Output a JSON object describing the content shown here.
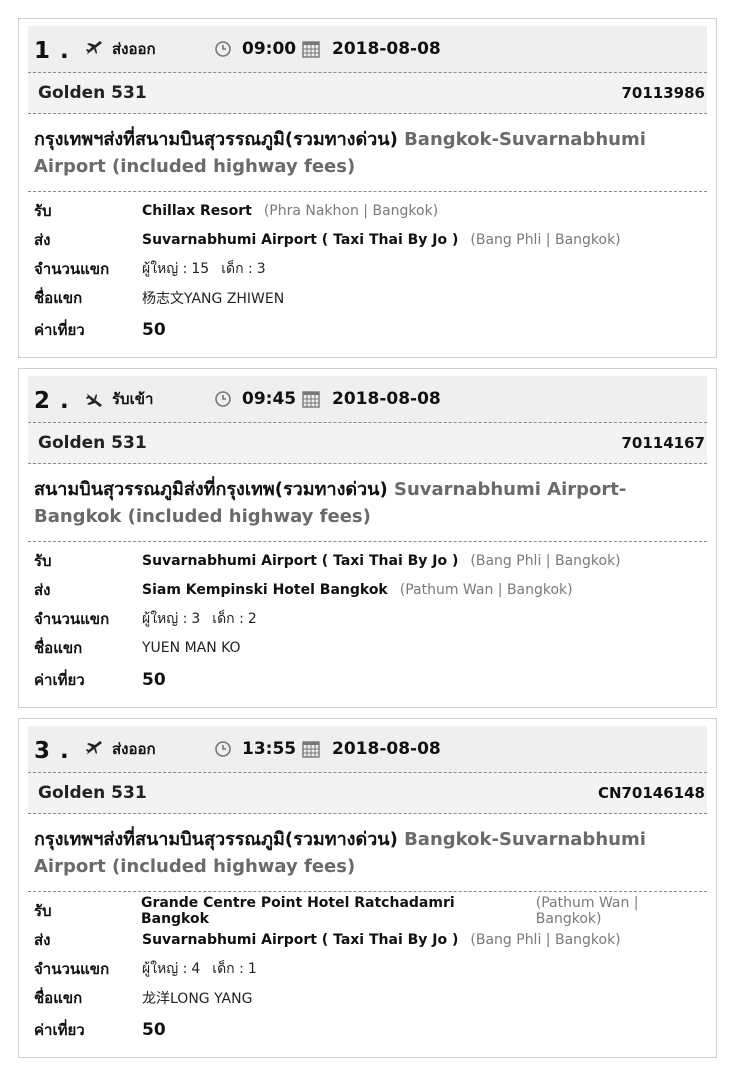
{
  "colors": {
    "header_bg": "#efefef",
    "subheader_bg": "#f3f3f3",
    "border": "#cfcfcf",
    "muted": "#6a6a6a"
  },
  "labels": {
    "pickup": "รับ",
    "dropoff": "ส่ง",
    "passengers": "จำนวนแขก",
    "guest_name": "ชื่อแขก",
    "fare": "ค่าเที่ยว",
    "adult": "ผู้ใหญ่ :",
    "child": "เด็ก :"
  },
  "bookings": [
    {
      "number": "1 .",
      "type_icon": "departure-plane-icon",
      "type_label": "ส่งออก",
      "time": "09:00",
      "date": "2018-08-08",
      "company": "Golden 531",
      "booking_no": "70113986",
      "route_th": "กรุงเทพฯส่งที่สนามบินสุวรรณภูมิ(รวมทางด่วน)",
      "route_en": "Bangkok-Suvarnabhumi Airport (included highway fees)",
      "pickup_name": "Chillax Resort",
      "pickup_area": "(Phra Nakhon | Bangkok)",
      "dropoff_name": "Suvarnabhumi Airport ( Taxi Thai By Jo )",
      "dropoff_area": "(Bang Phli | Bangkok)",
      "adults": "15",
      "children": "3",
      "guest": "杨志文YANG ZHIWEN",
      "fare": "50"
    },
    {
      "number": "2 .",
      "type_icon": "arrival-plane-icon",
      "type_label": "รับเข้า",
      "time": "09:45",
      "date": "2018-08-08",
      "company": "Golden 531",
      "booking_no": "70114167",
      "route_th": "สนามบินสุวรรณภูมิส่งที่กรุงเทพ(รวมทางด่วน)",
      "route_en": "Suvarnabhumi Airport-Bangkok (included highway fees)",
      "pickup_name": "Suvarnabhumi Airport ( Taxi Thai By Jo )",
      "pickup_area": "(Bang Phli | Bangkok)",
      "dropoff_name": "Siam Kempinski Hotel Bangkok",
      "dropoff_area": "(Pathum Wan | Bangkok)",
      "adults": "3",
      "children": "2",
      "guest": "YUEN MAN KO",
      "fare": "50"
    },
    {
      "number": "3 .",
      "type_icon": "departure-plane-icon",
      "type_label": "ส่งออก",
      "time": "13:55",
      "date": "2018-08-08",
      "company": "Golden 531",
      "booking_no": "CN70146148",
      "route_th": "กรุงเทพฯส่งที่สนามบินสุวรรณภูมิ(รวมทางด่วน)",
      "route_en": "Bangkok-Suvarnabhumi Airport (included highway fees)",
      "pickup_name": "Grande Centre Point Hotel Ratchadamri Bangkok",
      "pickup_area": "(Pathum Wan | Bangkok)",
      "dropoff_name": "Suvarnabhumi Airport ( Taxi Thai By Jo )",
      "dropoff_area": "(Bang Phli | Bangkok)",
      "adults": "4",
      "children": "1",
      "guest": "龙洋LONG YANG",
      "fare": "50"
    }
  ]
}
